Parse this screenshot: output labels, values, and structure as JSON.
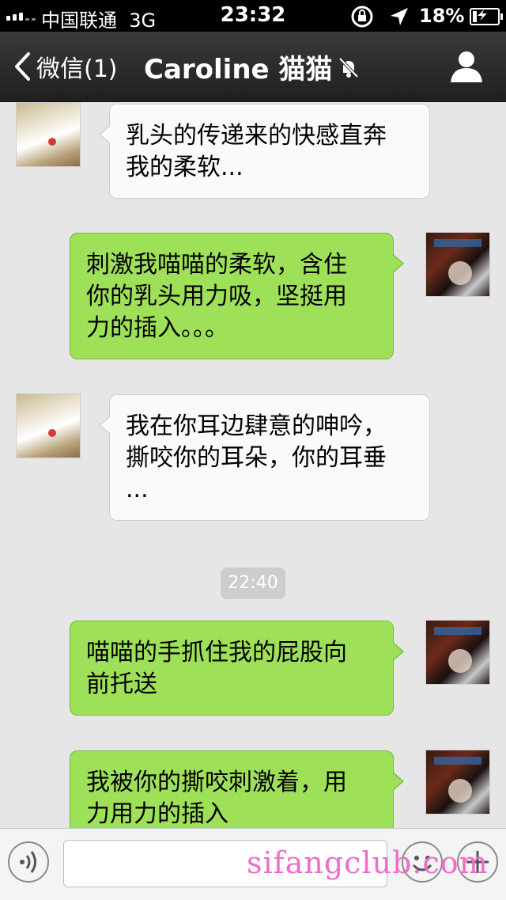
{
  "status_bar": {
    "carrier": "中国联通",
    "network": "3G",
    "time": "23:32",
    "battery": "18%",
    "battery_level": 0.18
  },
  "nav": {
    "back_label": "微信(1)",
    "title": "Caroline 猫猫",
    "icons": [
      "chevron-left-icon",
      "muted-bell-icon",
      "profile-icon"
    ]
  },
  "messages": [
    {
      "sender": "them",
      "text": "乳头的传递来的快感直奔\n我的柔软..."
    },
    {
      "sender": "me",
      "text": "刺激我喵喵的柔软，含住\n你的乳头用力吸，坚挺用\n力的插入。。。"
    },
    {
      "sender": "them",
      "text": "我在你耳边肆意的呻吟，\n撕咬你的耳朵，你的耳垂\n..."
    },
    {
      "sender": "me",
      "text": "喵喵的手抓住我的屁股向\n前托送"
    },
    {
      "sender": "me",
      "text": "我被你的撕咬刺激着，用\n力用力的插入"
    }
  ],
  "timestamp": "22:40",
  "input_bar": {
    "icons": [
      "voice-icon",
      "emoji-icon",
      "plus-icon"
    ]
  },
  "watermark": "sifangclub.com",
  "colors": {
    "nav_bg": "#2a2a2a",
    "chat_bg": "#e6e6e6",
    "my_bubble": "#9ee159",
    "their_bubble": "#fafafa",
    "watermark": "#f06cc8"
  }
}
